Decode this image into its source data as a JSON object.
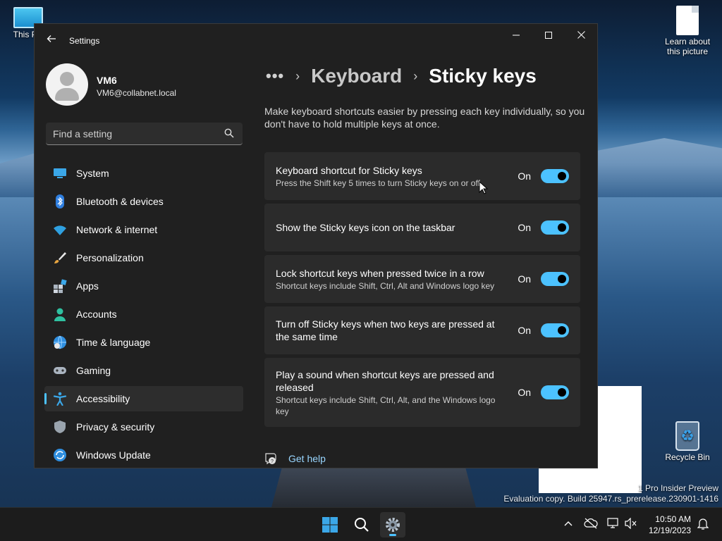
{
  "desktop": {
    "icons": {
      "this_pc": "This PC",
      "learn": "Learn about this picture",
      "recycle_bin": "Recycle Bin"
    },
    "watermark_line1": "1 Pro Insider Preview",
    "watermark_line2": "Evaluation copy. Build 25947.rs_prerelease.230901-1416"
  },
  "window": {
    "title": "Settings",
    "controls": [
      "minimize",
      "maximize",
      "close"
    ]
  },
  "user": {
    "name": "VM6",
    "email": "VM6@collabnet.local"
  },
  "search": {
    "placeholder": "Find a setting",
    "icon": "search-icon"
  },
  "nav": {
    "items": [
      {
        "label": "System",
        "icon": "system-icon"
      },
      {
        "label": "Bluetooth & devices",
        "icon": "bluetooth-icon"
      },
      {
        "label": "Network & internet",
        "icon": "wifi-icon"
      },
      {
        "label": "Personalization",
        "icon": "brush-icon"
      },
      {
        "label": "Apps",
        "icon": "apps-icon"
      },
      {
        "label": "Accounts",
        "icon": "accounts-icon"
      },
      {
        "label": "Time & language",
        "icon": "time-language-icon"
      },
      {
        "label": "Gaming",
        "icon": "gamepad-icon"
      },
      {
        "label": "Accessibility",
        "icon": "accessibility-icon",
        "active": true
      },
      {
        "label": "Privacy & security",
        "icon": "shield-icon"
      },
      {
        "label": "Windows Update",
        "icon": "update-icon"
      }
    ]
  },
  "breadcrumb": {
    "more": "•••",
    "parent": "Keyboard",
    "current": "Sticky keys"
  },
  "description": "Make keyboard shortcuts easier by pressing each key individually, so you don't have to hold multiple keys at once.",
  "settings": [
    {
      "title": "Keyboard shortcut for Sticky keys",
      "subtitle": "Press the Shift key 5 times to turn Sticky keys on or off",
      "state": "On",
      "enabled": true
    },
    {
      "title": "Show the Sticky keys icon on the taskbar",
      "subtitle": "",
      "state": "On",
      "enabled": true
    },
    {
      "title": "Lock shortcut keys when pressed twice in a row",
      "subtitle": "Shortcut keys include Shift, Ctrl, Alt and Windows logo key",
      "state": "On",
      "enabled": true
    },
    {
      "title": "Turn off Sticky keys when two keys are pressed at the same time",
      "subtitle": "",
      "state": "On",
      "enabled": true
    },
    {
      "title": "Play a sound when shortcut keys are pressed and released",
      "subtitle": "Shortcut keys include Shift, Ctrl, Alt, and the Windows logo key",
      "state": "On",
      "enabled": true
    }
  ],
  "help": {
    "label": "Get help"
  },
  "taskbar": {
    "apps": [
      "start-icon",
      "search-icon",
      "settings-icon"
    ],
    "active_app": "settings-icon",
    "clock_time": "10:50 AM",
    "clock_date": "12/19/2023"
  },
  "colors": {
    "accent": "#4cc2ff",
    "window_bg": "#202020",
    "card_bg": "#2b2b2b",
    "link": "#99d6ff"
  }
}
